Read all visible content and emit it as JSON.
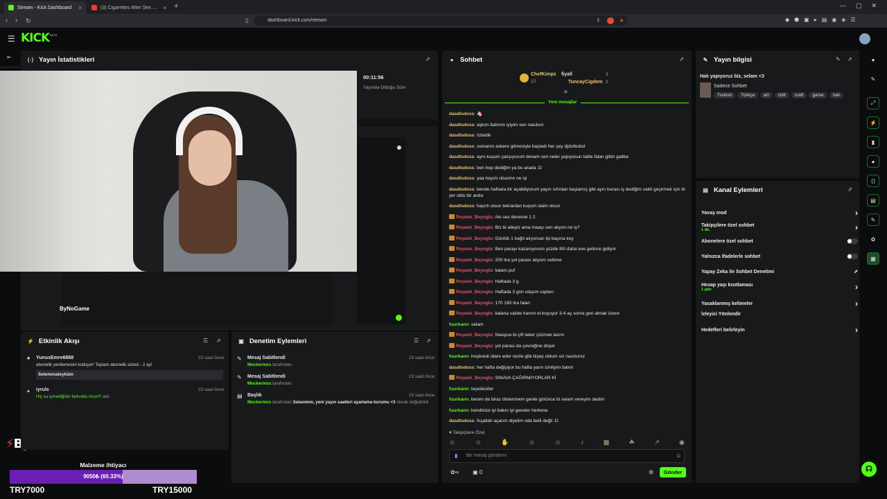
{
  "browser": {
    "tabs": [
      {
        "title": "Stream - Kick Dashboard",
        "active": true
      },
      {
        "title": "(3) Cigarettes After Sex Late Nig",
        "active": false
      }
    ],
    "url": "dashboard.kick.com/stream"
  },
  "app": {
    "logo": "KICK",
    "logo_tag": "BETA"
  },
  "stats": {
    "title": "Yayın İstatistikleri",
    "time": "00:11:56",
    "time_label": "Yayında Olduğu Süre"
  },
  "overlay": {
    "brand": "ByNoGame",
    "goal_label": "Malzeme ihtiyacı",
    "goal_value": "9050₺ (60.33%)",
    "goal_percent": 60.33,
    "start": "TRY7000",
    "end": "TRY15000"
  },
  "events": {
    "title": "Etkinlik Akışı",
    "items": [
      {
        "user": "YunusEmre6888",
        "text": "abonelik yenilemesini kutluyor! Toplam abonelik süresi - 2 ay!",
        "time": "23 saat önce",
        "quote": "Selemmaleyküm"
      },
      {
        "user": "iyruls",
        "text": "Hiç su içmediğinin farkında mısın?",
        "suffix": "aldı",
        "time": "23 saat önce"
      }
    ]
  },
  "moderation": {
    "title": "Denetim Eylemleri",
    "items": [
      {
        "title": "Mesaj Sabitlendi",
        "user": "Mockermos",
        "text": "tarafından",
        "time": "23 saat önce"
      },
      {
        "title": "Mesaj Sabitlendi",
        "user": "Mockermos",
        "text": "tarafından",
        "time": "23 saat önce"
      },
      {
        "title": "Başlık",
        "user": "Mockermos",
        "text": "tarafından",
        "bold": "Selammm, yeni yayın saatleri ayarlama kurumu <3",
        "suffix": "olarak değiştirildi",
        "time": "23 saat önce"
      }
    ]
  },
  "chat": {
    "title": "Sohbet",
    "leaders": [
      {
        "name": "ChefKimpz",
        "count": "12"
      },
      {
        "name": "fiyall",
        "count": "3"
      },
      {
        "name": "TuncayCigdem",
        "count": "2"
      }
    ],
    "new_messages": "Yeni mesajlar",
    "messages": [
      {
        "user": "dasdlsdoss",
        "text": "🦄",
        "color": "#e8c27a",
        "badge": false
      },
      {
        "user": "dasdlsdoss",
        "text": "aşkım balımm iyiyim sen nasılsın",
        "color": "#e8c27a",
        "badge": false
      },
      {
        "user": "dasdlsdoss",
        "text": "özledik",
        "color": "#e8c27a",
        "badge": false
      },
      {
        "user": "dasdlsdoss",
        "text": "osmanın askere gitmesiyle başladı her şey djdshkdsd",
        "color": "#e8c27a",
        "badge": false
      },
      {
        "user": "dasdlsdoss",
        "text": "aynı kuşum çalışıyorum devam sen neler yapıyosun tatile falan gittin galiba",
        "color": "#e8c27a",
        "badge": false
      },
      {
        "user": "dasdlsdoss",
        "text": "ben hep dediğim ya bu arada :D",
        "color": "#e8c27a",
        "badge": false
      },
      {
        "user": "dasdlsdoss",
        "text": "yaa hayırlı olsunnn ne işi",
        "color": "#e8c27a",
        "badge": false
      },
      {
        "user": "dasdlsdoss",
        "text": "bende haftada bir açabiliyorum yayın sıfırdan başlamış gibi aynı burası iş dediğim vakit geçirmek için bi yer oldu bir anda",
        "color": "#e8c27a",
        "badge": false,
        "wrap": true
      },
      {
        "user": "dasdlsdoss",
        "text": "hayırlı olsun tekrardan kuşum daim olsun",
        "color": "#e8c27a",
        "badge": false
      },
      {
        "user": "Peyami_Beyoglu",
        "text": "Alo ses deneme 1 2",
        "color": "#e0566b",
        "badge": true
      },
      {
        "user": "Peyami_Beyoglu",
        "text": "Biz bi aileyiz ama maaşı sen alıyon ne iş?",
        "color": "#e0566b",
        "badge": true
      },
      {
        "user": "Peyami_Beyoglu",
        "text": "Günlük 1 kağıt alıyorsan ilp başına koy",
        "color": "#e0566b",
        "badge": true
      },
      {
        "user": "Peyami_Beyoglu",
        "text": "Ben parayı kazanıyorum yüzde 80i daha eve gelince gidiyor",
        "color": "#e0566b",
        "badge": true
      },
      {
        "user": "Peyami_Beyoglu",
        "text": "200 lira yol parası alıyom cebime",
        "color": "#e0566b",
        "badge": true
      },
      {
        "user": "Peyami_Beyoglu",
        "text": "kalanı puf",
        "color": "#e0566b",
        "badge": true
      },
      {
        "user": "Peyami_Beyoglu",
        "text": "Haftada 3 g",
        "color": "#e0566b",
        "badge": true
      },
      {
        "user": "Peyami_Beyoglu",
        "text": "Haftada 3 gün ulaşım capten",
        "color": "#e0566b",
        "badge": true
      },
      {
        "user": "Peyami_Beyoglu",
        "text": "170 180 lira falan",
        "color": "#e0566b",
        "badge": true
      },
      {
        "user": "Peyami_Beyoglu",
        "text": "kalana valide hanım el koyuyor 3-4 ay sonra geri almak üzere",
        "color": "#e0566b",
        "badge": true
      },
      {
        "user": "fuurkann",
        "text": "selam",
        "color": "#53fc18",
        "badge": false
      },
      {
        "user": "Peyami_Beyoglu",
        "text": "Nasipse bi çift teker çözmek lazım",
        "color": "#e0566b",
        "badge": true
      },
      {
        "user": "Peyami_Beyoglu",
        "text": "yol parası da çevreğine düşer",
        "color": "#e0566b",
        "badge": true
      },
      {
        "user": "fuurkann",
        "text": "hoşbuluk idare eder nezle gibi bişey oldum siz nasılsınız",
        "color": "#53fc18",
        "badge": false
      },
      {
        "user": "dasdlsdoss",
        "text": "her hafta değişiyor bu hafta yarın izinliyim balım",
        "color": "#e8c27a",
        "badge": false
      },
      {
        "user": "Peyami_Beyoglu",
        "text": "SINAVA ÇAĞIRMIYORLAR Kİ",
        "color": "#e0566b",
        "badge": true
      },
      {
        "user": "fuurkann",
        "text": "teşekkürler",
        "color": "#53fc18",
        "badge": false
      },
      {
        "user": "fuurkann",
        "text": "benim de biraz dinlenmem gerek görünce bi selam vereyim dedim",
        "color": "#53fc18",
        "badge": false
      },
      {
        "user": "fuurkann",
        "text": "kendinize iyi bakın iyi geceler herkese",
        "color": "#53fc18",
        "badge": false
      },
      {
        "user": "dasdlsdoss",
        "text": "İnşallah açarım diyelim oda belli değil :D",
        "color": "#e8c27a",
        "badge": false
      }
    ],
    "mode": "Takipçilere Özel",
    "placeholder": "Bir mesaj gönderin",
    "send": "Gönder",
    "viewers": "0"
  },
  "info": {
    "title": "Yayın bilgisi",
    "stream_title": "Halı yapıyoruz biz, selam <3",
    "category": "Sadece Sohbet",
    "tags": [
      "Turkish",
      "Türkçe",
      "art",
      "chill",
      "craft",
      "game",
      "hali"
    ]
  },
  "actions": {
    "title": "Kanal Eylemleri",
    "items": [
      {
        "label": "Yavaş mod",
        "control": "chevron"
      },
      {
        "label": "Takipçilere özel sohbet",
        "sub": "1 dk.",
        "control": "chevron"
      },
      {
        "label": "Abonelere özel sohbet",
        "control": "toggle"
      },
      {
        "label": "Yalnızca ifadelerle sohbet",
        "control": "toggle"
      },
      {
        "label": "Yapay Zeka ile Sohbet Denetimi",
        "control": "external"
      },
      {
        "label": "Hesap yaşı kısıtlaması",
        "sub": "1 gün",
        "control": "chevron"
      },
      {
        "label": "Yasaklanmış kelimeler",
        "control": "chevron"
      },
      {
        "label": "İzleyici Yönlendir",
        "control": "none"
      },
      {
        "label": "Hedefleri belirleyin",
        "control": "chevron"
      }
    ]
  },
  "colors": {
    "accent": "#53fc18",
    "panel": "#18191b",
    "bg": "#0b0c0d"
  }
}
